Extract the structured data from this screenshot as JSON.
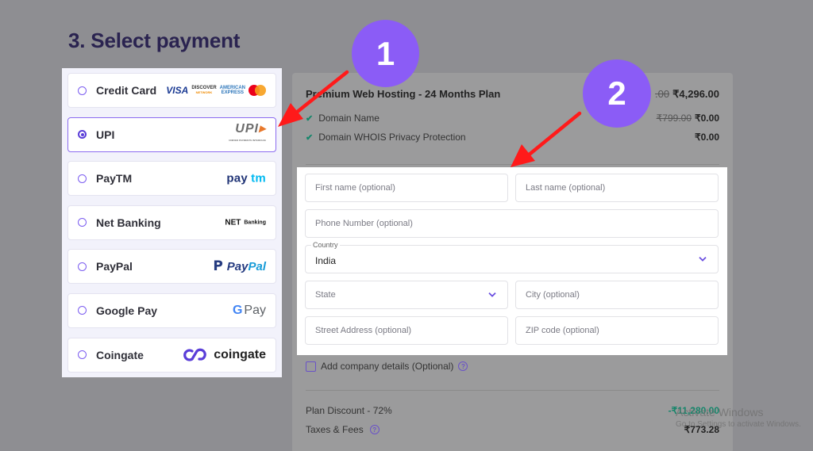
{
  "page": {
    "title": "3. Select payment"
  },
  "payment_methods": [
    {
      "label": "Credit Card",
      "selected": false,
      "logo": "visa-discover-amex-mastercard-icon"
    },
    {
      "label": "UPI",
      "selected": true,
      "logo": "upi-icon"
    },
    {
      "label": "PayTM",
      "selected": false,
      "logo": "paytm-icon"
    },
    {
      "label": "Net Banking",
      "selected": false,
      "logo": "net-banking-icon"
    },
    {
      "label": "PayPal",
      "selected": false,
      "logo": "paypal-icon"
    },
    {
      "label": "Google Pay",
      "selected": false,
      "logo": "google-pay-icon"
    },
    {
      "label": "Coingate",
      "selected": false,
      "logo": "coingate-icon"
    }
  ],
  "logos": {
    "visa": "VISA",
    "discover": "DISCOVER",
    "discover_sub": "NETWORK",
    "amex_1": "AMERICAN",
    "amex_2": "EXPRESS",
    "upi": "UPI",
    "upi_sub": "UNIFIED PAYMENTS INTERFACE",
    "paytm_pay": "pay",
    "paytm_tm": "tm",
    "netbanking_1": "NET",
    "netbanking_2": "Banking",
    "paypal_pay": "Pay",
    "paypal_pal": "Pal",
    "gpay_g": "G",
    "gpay_pay": "Pay",
    "coingate": "coingate"
  },
  "summary": {
    "plan_title": "Premium Web Hosting - 24 Months Plan",
    "plan_old_price": ".00",
    "plan_price": "₹4,296.00",
    "items": [
      {
        "label": "Domain Name",
        "old_price": "₹799.00",
        "price": "₹0.00"
      },
      {
        "label": "Domain WHOIS Privacy Protection",
        "old_price": "",
        "price": "₹0.00"
      }
    ],
    "plan_discount_label": "Plan Discount - 72%",
    "plan_discount_value": "-₹11,280.00",
    "taxes_label": "Taxes & Fees",
    "taxes_value": "₹773.28"
  },
  "form": {
    "first_name_placeholder": "First name (optional)",
    "last_name_placeholder": "Last name (optional)",
    "phone_placeholder": "Phone Number (optional)",
    "country_label": "Country",
    "country_value": "India",
    "state_placeholder": "State",
    "city_placeholder": "City (optional)",
    "street_placeholder": "Street Address (optional)",
    "zip_placeholder": "ZIP code (optional)",
    "company_checkbox_label": "Add company details (Optional)",
    "company_checked": false
  },
  "annotations": {
    "badge_1": "1",
    "badge_2": "2"
  },
  "watermark": {
    "line1": "Activate Windows",
    "line2": "Go to Settings to activate Windows."
  },
  "colors": {
    "accent": "#8b5cf6",
    "title": "#2a2350",
    "arrow": "#ff1a1a",
    "discount": "#16866b"
  }
}
